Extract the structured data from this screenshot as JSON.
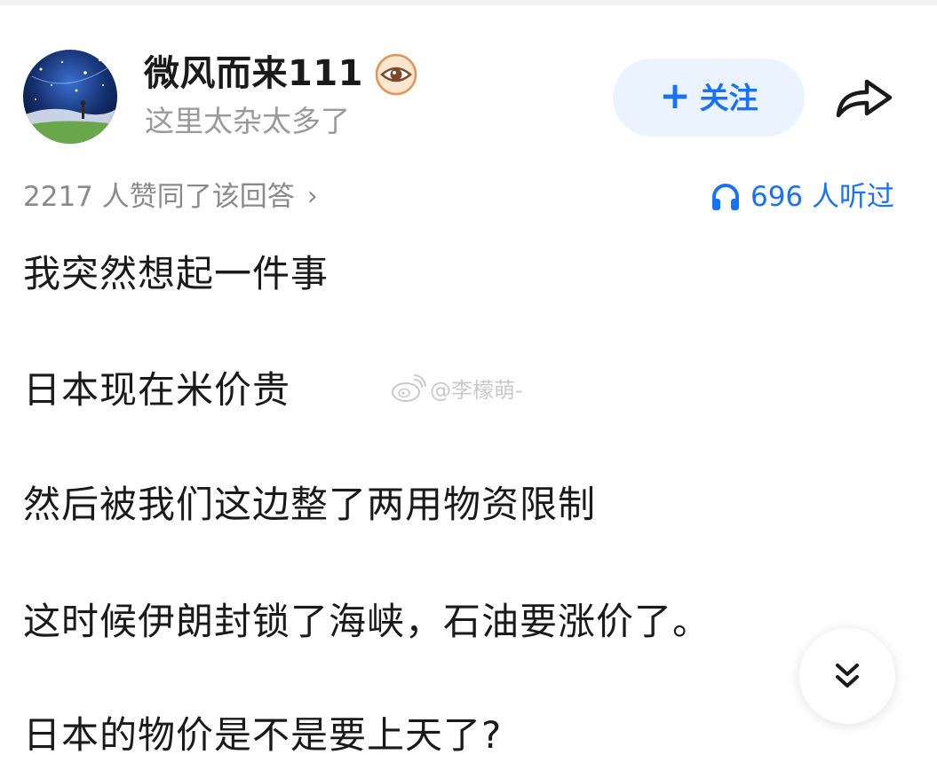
{
  "author": {
    "name": "微风而来111",
    "description": "这里太杂太多了",
    "badge_icon": "eye-badge-icon",
    "avatar": "starry-night-avatar"
  },
  "actions": {
    "follow_plus": "+",
    "follow_label": "关注",
    "share_icon": "share-arrow-icon"
  },
  "stats": {
    "upvote_text": "2217 人赞同了该回答",
    "upvote_chevron": "›",
    "listen_text": "696 人听过",
    "listen_icon": "headphone-icon"
  },
  "content": {
    "paragraphs": [
      "我突然想起一件事",
      "日本现在米价贵",
      "然后被我们这边整了两用物资限制",
      "这时候伊朗封锁了海峡，石油要涨价了。",
      "日本的物价是不是要上天了?"
    ]
  },
  "watermark": {
    "text": "@李檬萌-",
    "icon": "weibo-icon"
  },
  "scroll_button": {
    "icon": "double-chevron-down-icon"
  },
  "colors": {
    "accent": "#1772f6",
    "follow_bg": "#ebf3ff",
    "muted_text": "#8a8a8a"
  }
}
